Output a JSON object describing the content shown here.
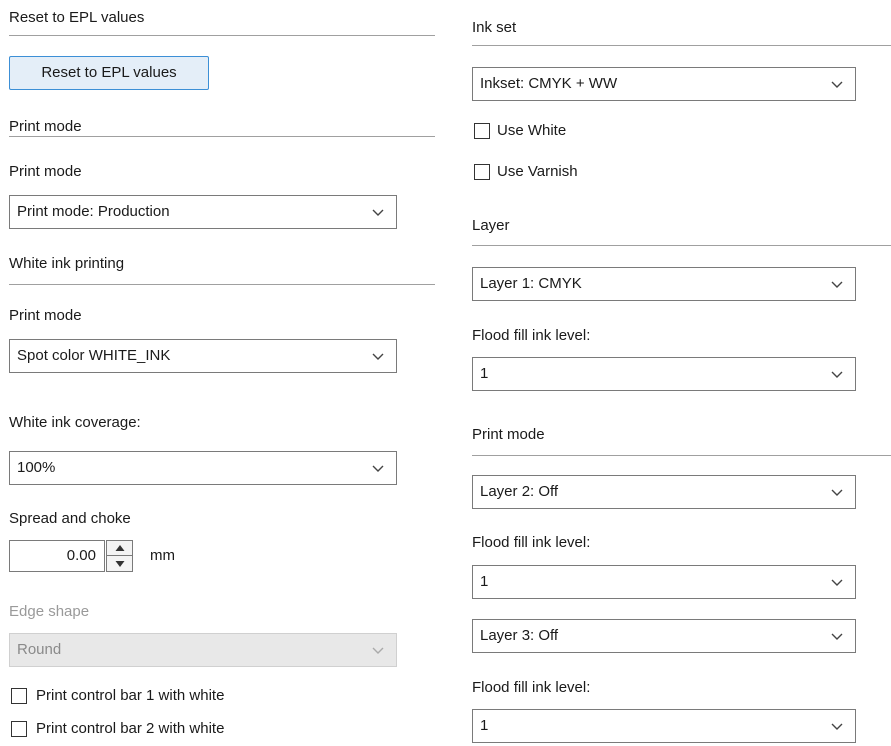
{
  "left": {
    "reset_section_title": "Reset to EPL values",
    "reset_button_label": "Reset to EPL values",
    "print_mode_section_title": "Print mode",
    "print_mode_label": "Print mode",
    "print_mode_value": "Print mode: Production",
    "white_ink_section_title": "White ink printing",
    "white_print_mode_label": "Print mode",
    "white_print_mode_value": "Spot color WHITE_INK",
    "coverage_label": "White ink coverage:",
    "coverage_value": "100%",
    "spread_label": "Spread and choke",
    "spread_value": "0.00",
    "spread_unit": "mm",
    "edge_shape_label": "Edge shape",
    "edge_shape_value": "Round",
    "control_bar_1_label": "Print control bar 1 with white",
    "control_bar_2_label": "Print control bar 2 with white"
  },
  "right": {
    "ink_set_section_title": "Ink set",
    "ink_set_value": "Inkset: CMYK + WW",
    "use_white_label": "Use White",
    "use_varnish_label": "Use Varnish",
    "layer_section_title": "Layer",
    "layer1_value": "Layer 1: CMYK",
    "flood_fill_label_1": "Flood fill ink level:",
    "flood_fill_value_1": "1",
    "print_mode_section_title": "Print mode",
    "layer2_value": "Layer 2: Off",
    "flood_fill_label_2": "Flood fill ink level:",
    "flood_fill_value_2": "1",
    "layer3_value": "Layer 3: Off",
    "flood_fill_label_3": "Flood fill ink level:",
    "flood_fill_value_3": "1"
  },
  "checkboxes": {
    "use_white": false,
    "use_varnish": false,
    "control_bar_1": false,
    "control_bar_2": false
  },
  "colors": {
    "button_border": "#3c8fd6",
    "button_fill": "#e4eef8",
    "disabled_text": "#9a9a9a"
  }
}
